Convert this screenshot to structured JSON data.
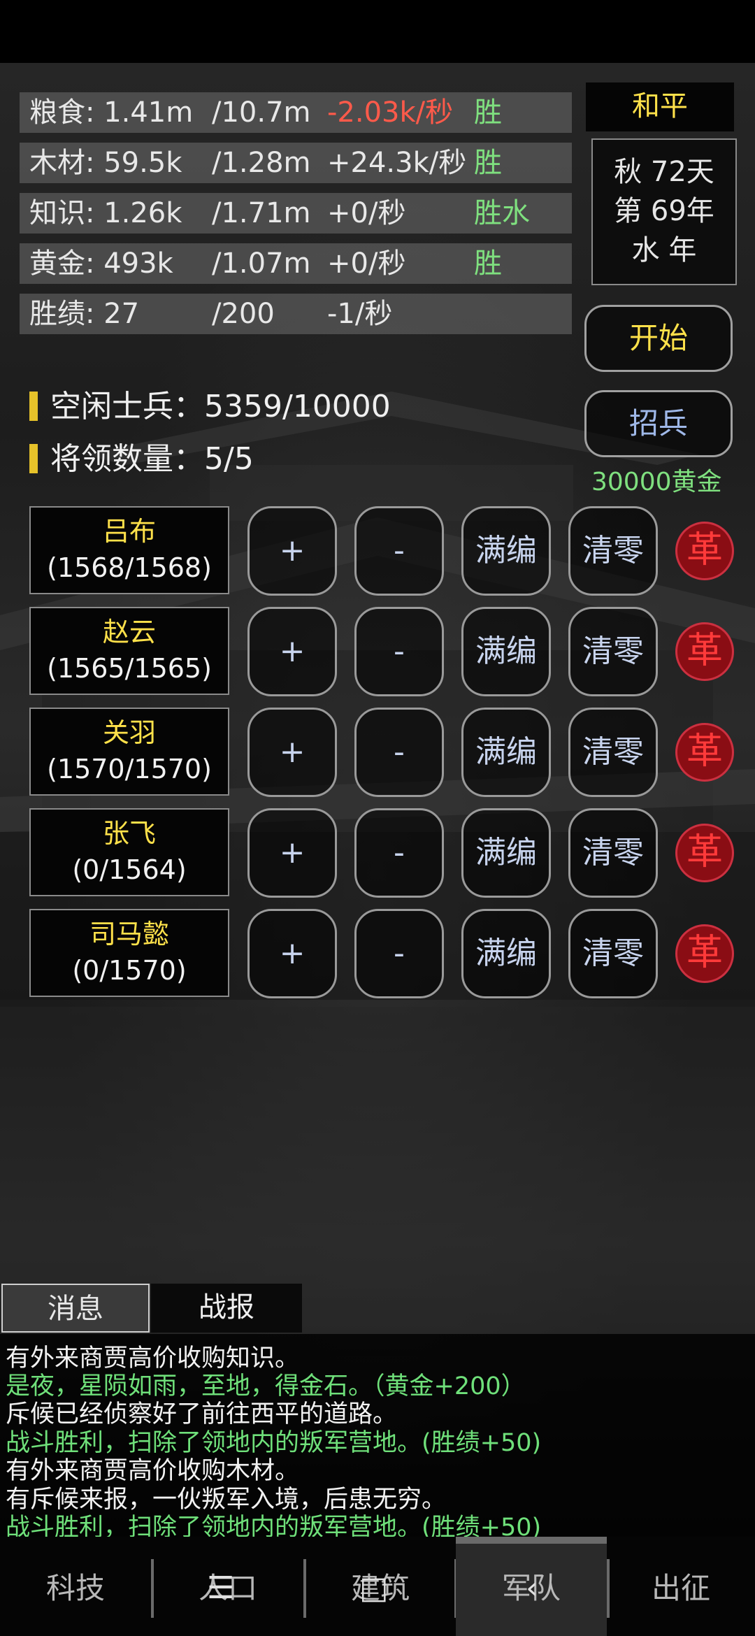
{
  "resources": [
    {
      "name": "粮食: 1.41m",
      "cap": "/10.7m",
      "rate": "-2.03k/秒",
      "tag": "胜",
      "rate_color": "#ff5a4a"
    },
    {
      "name": "木材: 59.5k",
      "cap": "/1.28m",
      "rate": "+24.3k/秒",
      "tag": "胜"
    },
    {
      "name": "知识: 1.26k",
      "cap": "/1.71m",
      "rate": "+0/秒",
      "tag": "胜水"
    },
    {
      "name": "黄金: 493k",
      "cap": "/1.07m",
      "rate": "+0/秒",
      "tag": "胜"
    },
    {
      "name": "胜绩: 27",
      "cap": "/200",
      "rate": "-1/秒",
      "tag": ""
    }
  ],
  "status": {
    "peace": "和平",
    "season": "秋 72天",
    "year": "第 69年",
    "element": "水 年"
  },
  "actions": {
    "start": "开始",
    "recruit": "招兵",
    "recruit_cost": "30000黄金"
  },
  "info": {
    "idle_soldiers": "空闲士兵：5359/10000",
    "generals": "将领数量：5/5"
  },
  "button_labels": {
    "plus": "+",
    "minus": "-",
    "full": "满编",
    "clear": "清零",
    "revolt": "革"
  },
  "generals": [
    {
      "name": "吕布",
      "troops": "(1568/1568)"
    },
    {
      "name": "赵云",
      "troops": "(1565/1565)"
    },
    {
      "name": "关羽",
      "troops": "(1570/1570)"
    },
    {
      "name": "张飞",
      "troops": "(0/1564)"
    },
    {
      "name": "司马懿",
      "troops": "(0/1570)"
    }
  ],
  "log_tabs": {
    "messages": "消息",
    "battle_report": "战报"
  },
  "log": [
    {
      "text": "有外来商贾高价收购知识。",
      "color": "white"
    },
    {
      "text": "是夜，星陨如雨，至地，得金石。（黄金+200）",
      "color": "green"
    },
    {
      "text": "斥候已经侦察好了前往西平的道路。",
      "color": "white"
    },
    {
      "text": "战斗胜利，扫除了领地内的叛军营地。(胜绩+50)",
      "color": "green"
    },
    {
      "text": "有外来商贾高价收购木材。",
      "color": "white"
    },
    {
      "text": "有斥候来报，一伙叛军入境，后患无穷。",
      "color": "white"
    },
    {
      "text": "战斗胜利，扫除了领地内的叛军营地。(胜绩+50)",
      "color": "green"
    }
  ],
  "nav": {
    "tech": "科技",
    "population": "人口",
    "building": "建筑",
    "army": "军队",
    "expedition": "出征",
    "selected": "army"
  },
  "colors": {
    "yellow": "#ffe14a",
    "green": "#6fe07a",
    "red": "#ff5a4a",
    "revolt_bg": "#8a0d14"
  }
}
